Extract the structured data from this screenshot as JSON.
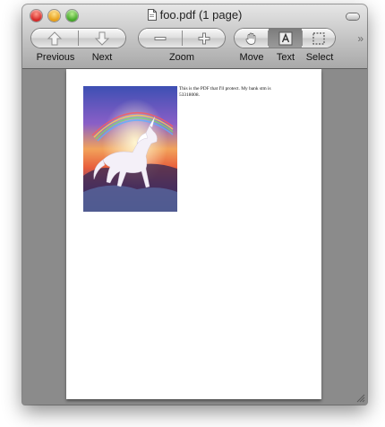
{
  "window": {
    "title": "foo.pdf (1 page)",
    "icon": "pdf-document-icon"
  },
  "toolbar": {
    "nav": {
      "previous_label": "Previous",
      "next_label": "Next",
      "previous_icon": "up-arrow-icon",
      "next_icon": "down-arrow-icon"
    },
    "zoom": {
      "label": "Zoom",
      "out_icon": "minus-icon",
      "in_icon": "plus-icon"
    },
    "tools": {
      "move_label": "Move",
      "text_label": "Text",
      "select_label": "Select",
      "move_icon": "hand-icon",
      "text_icon": "text-cursor-icon",
      "select_icon": "marquee-select-icon",
      "active": "Text"
    },
    "overflow_glyph": "»"
  },
  "document": {
    "page_text": "This is the PDF that I'll protect. My bank stm is 53318008.",
    "image_description_icon": "unicorn-rainbow-image"
  }
}
